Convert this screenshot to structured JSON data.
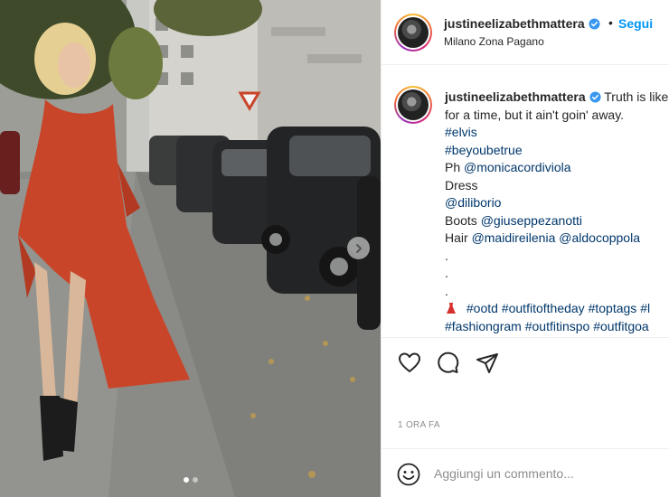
{
  "post": {
    "username": "justineelizabethmattera",
    "follow_label": "Segui",
    "separator": "•",
    "location": "Milano Zona Pagano",
    "time_ago": "1 ORA FA"
  },
  "caption": {
    "username": "justineelizabethmattera",
    "text_line1": "Truth is like",
    "text_line2": "for a time, but it ain't goin' away.",
    "hashtag_elvis": "#elvis",
    "hashtag_beyoubetrue": "#beyoubetrue",
    "ph_label": "Ph",
    "ph_mention": "@monicacordiviola",
    "dress_label": "Dress",
    "dress_mention": "@diliborio",
    "boots_label": "Boots",
    "boots_mention": "@giuseppezanotti",
    "hair_label": "Hair",
    "hair_mention1": "@maidireilenia",
    "hair_mention2": "@aldocoppola",
    "dot1": ".",
    "dot2": ".",
    "dot3": ".",
    "tags_line1": [
      "#ootd",
      "#outfitoftheday",
      "#toptags",
      "#l"
    ],
    "tags_line2": [
      "#fashiongram",
      "#outfitinspo",
      "#outfitgoa"
    ]
  },
  "comment": {
    "placeholder": "Aggiungi un commento..."
  },
  "carousel": {
    "slide_count": 2,
    "active_index": 0
  },
  "icons": {
    "like": "heart-icon",
    "comment": "comment-icon",
    "share": "paper-plane-icon",
    "emoji": "smiley-icon",
    "next": "chevron-right-icon",
    "verified": "verified-badge-icon"
  },
  "colors": {
    "link": "#0095f6",
    "hashtag": "#00376b",
    "muted": "#8e8e8e",
    "verified": "#3897f0",
    "dress": "#c9452a"
  }
}
